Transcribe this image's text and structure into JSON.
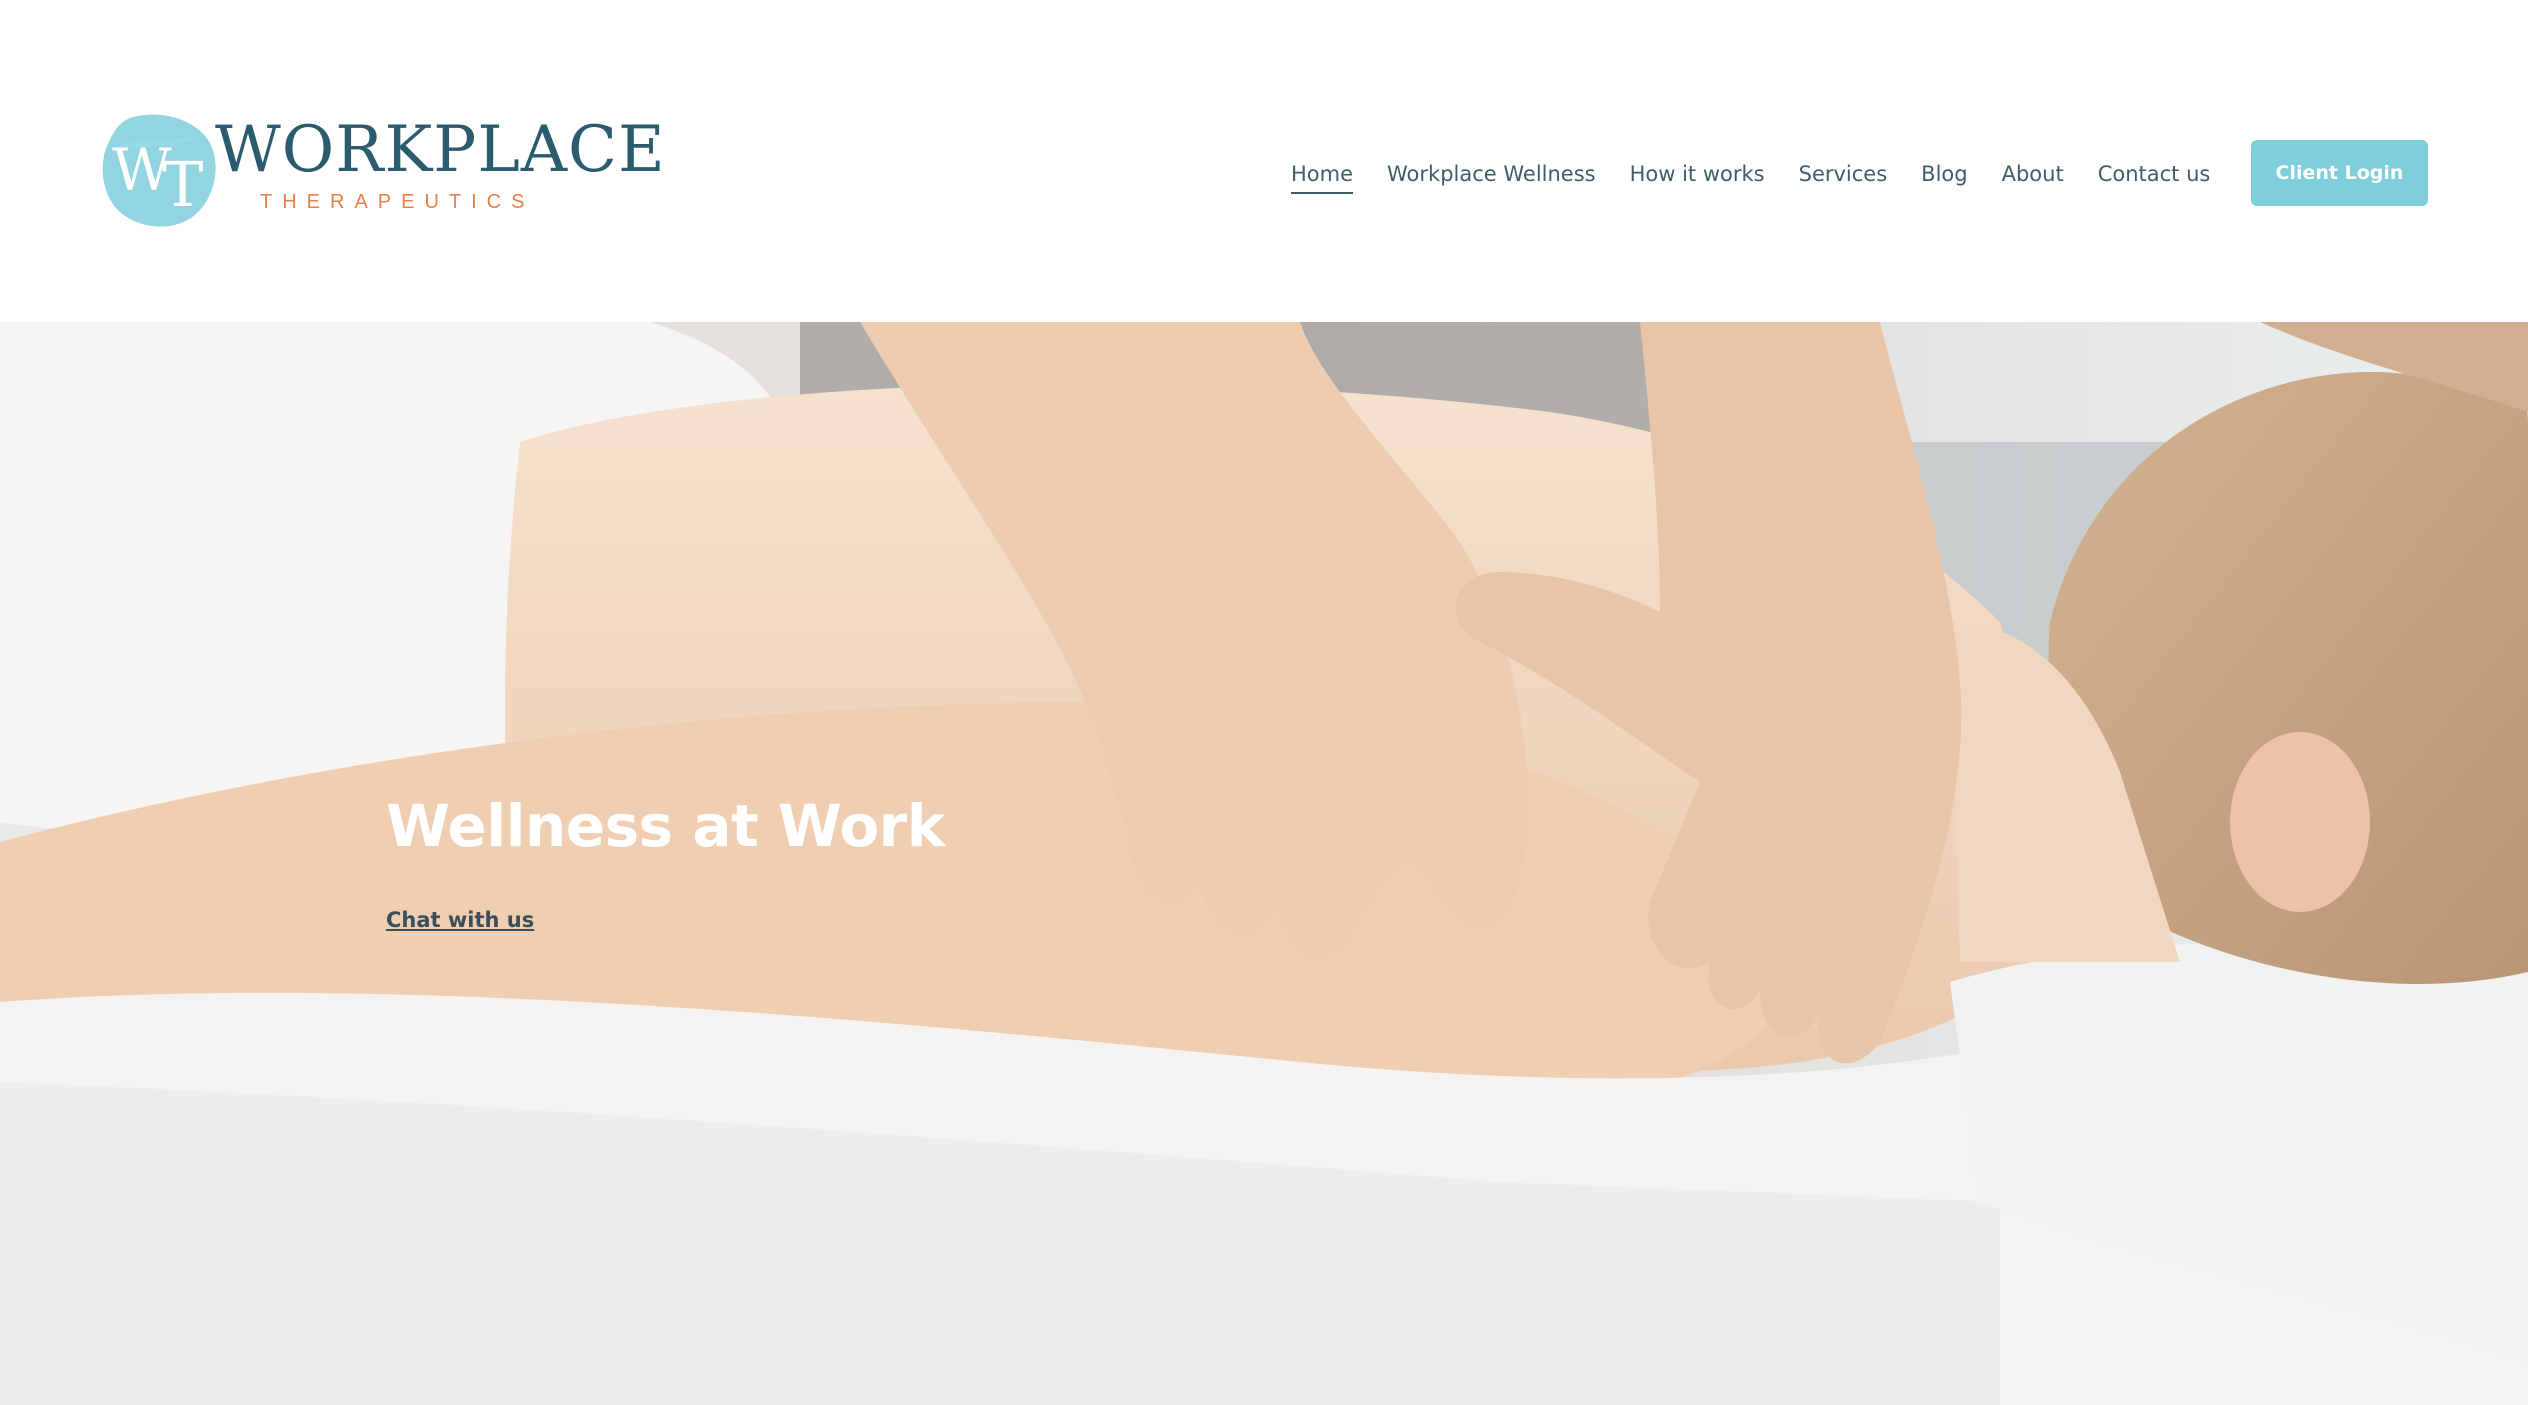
{
  "brand": {
    "name": "WORKPLACE",
    "tagline": "THERAPEUTICS",
    "monogram": "WT",
    "colors": {
      "primary": "#2b5c6e",
      "accent": "#e3824c",
      "teal": "#7fcedb"
    }
  },
  "nav": {
    "items": [
      {
        "label": "Home",
        "active": true
      },
      {
        "label": "Workplace Wellness",
        "active": false
      },
      {
        "label": "How it works",
        "active": false
      },
      {
        "label": "Services",
        "active": false
      },
      {
        "label": "Blog",
        "active": false
      },
      {
        "label": "About",
        "active": false
      },
      {
        "label": "Contact us",
        "active": false
      }
    ],
    "login_label": "Client Login"
  },
  "hero": {
    "title": "Wellness at Work",
    "cta_label": "Chat with us"
  }
}
